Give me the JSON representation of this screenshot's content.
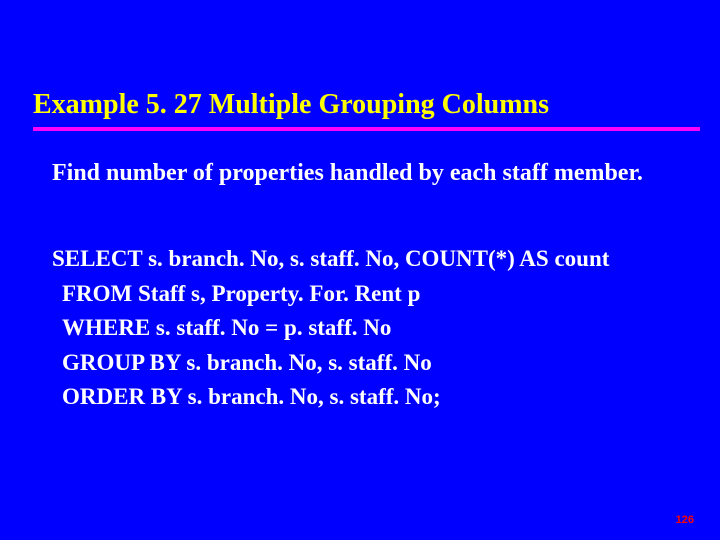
{
  "title": "Example 5. 27  Multiple Grouping Columns",
  "problem": "Find number of properties handled by each staff member.",
  "sql": {
    "l1": "SELECT s. branch. No, s. staff. No, COUNT(*) AS count",
    "l2": "FROM Staff s, Property. For. Rent p",
    "l3": "WHERE s. staff. No = p. staff. No",
    "l4": "GROUP BY s. branch. No, s. staff. No",
    "l5": "ORDER BY s. branch. No, s. staff. No;"
  },
  "page_number": "126"
}
